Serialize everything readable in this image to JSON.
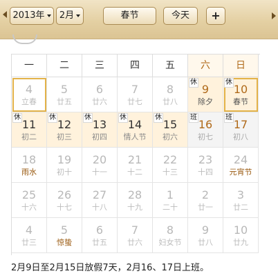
{
  "toolbar": {
    "year_label": "2013年",
    "month_label": "2月",
    "festival_label": "春节",
    "today_label": "今天",
    "add_label": "+"
  },
  "weekdays": [
    "一",
    "二",
    "三",
    "四",
    "五",
    "六",
    "日"
  ],
  "weeks": [
    [
      {
        "day": "4",
        "lunar": "立春",
        "state": "selected"
      },
      {
        "day": "5",
        "lunar": "廿五",
        "state": "normal"
      },
      {
        "day": "6",
        "lunar": "廿六",
        "state": "normal"
      },
      {
        "day": "7",
        "lunar": "廿七",
        "state": "normal"
      },
      {
        "day": "8",
        "lunar": "廿八",
        "state": "normal"
      },
      {
        "day": "9",
        "lunar": "除夕",
        "state": "holiday",
        "tag": "休"
      },
      {
        "day": "10",
        "lunar": "春节",
        "state": "holiday",
        "tag": "休",
        "today": true
      }
    ],
    [
      {
        "day": "11",
        "lunar": "初二",
        "state": "holiday",
        "tag": "休"
      },
      {
        "day": "12",
        "lunar": "初三",
        "state": "holiday",
        "tag": "休"
      },
      {
        "day": "13",
        "lunar": "初四",
        "state": "holiday",
        "tag": "休"
      },
      {
        "day": "14",
        "lunar": "情人节",
        "state": "holiday",
        "tag": "休"
      },
      {
        "day": "15",
        "lunar": "初六",
        "state": "holiday",
        "tag": "休"
      },
      {
        "day": "16",
        "lunar": "初七",
        "state": "work",
        "tag": "班"
      },
      {
        "day": "17",
        "lunar": "初八",
        "state": "work",
        "tag": "班"
      }
    ],
    [
      {
        "day": "18",
        "lunar": "雨水",
        "state": "festival"
      },
      {
        "day": "19",
        "lunar": "初十",
        "state": "normal"
      },
      {
        "day": "20",
        "lunar": "十一",
        "state": "normal"
      },
      {
        "day": "21",
        "lunar": "十二",
        "state": "normal"
      },
      {
        "day": "22",
        "lunar": "十三",
        "state": "normal"
      },
      {
        "day": "23",
        "lunar": "十四",
        "state": "normal"
      },
      {
        "day": "24",
        "lunar": "元宵节",
        "state": "festival"
      }
    ],
    [
      {
        "day": "25",
        "lunar": "十六",
        "state": "normal"
      },
      {
        "day": "26",
        "lunar": "十七",
        "state": "normal"
      },
      {
        "day": "27",
        "lunar": "十八",
        "state": "normal"
      },
      {
        "day": "28",
        "lunar": "十九",
        "state": "normal"
      },
      {
        "day": "1",
        "lunar": "二十",
        "state": "normal"
      },
      {
        "day": "2",
        "lunar": "廿一",
        "state": "normal"
      },
      {
        "day": "3",
        "lunar": "廿二",
        "state": "normal"
      }
    ],
    [
      {
        "day": "4",
        "lunar": "廿三",
        "state": "normal"
      },
      {
        "day": "5",
        "lunar": "惊蛰",
        "state": "festival"
      },
      {
        "day": "6",
        "lunar": "廿五",
        "state": "normal"
      },
      {
        "day": "7",
        "lunar": "廿六",
        "state": "normal"
      },
      {
        "day": "8",
        "lunar": "妇女节",
        "state": "normal"
      },
      {
        "day": "9",
        "lunar": "廿八",
        "state": "normal"
      },
      {
        "day": "10",
        "lunar": "廿九",
        "state": "normal"
      }
    ]
  ],
  "footnote": "2月9日至2月15日放假7天，2月16、17日上班。",
  "colors": {
    "toolbar_bg": "#e4d0a3",
    "holiday_bg": "#fff2dc",
    "weekend_text": "#b06a1a",
    "selected_border": "#e3b248"
  }
}
